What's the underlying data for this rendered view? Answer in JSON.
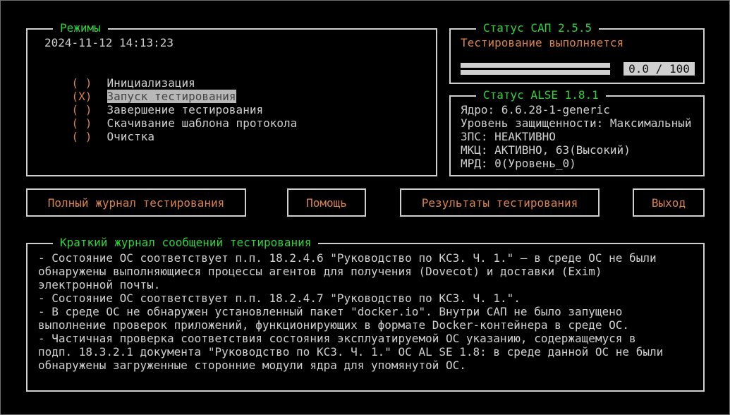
{
  "modes_panel": {
    "title": "Режимы",
    "datetime": "2024-11-12 14:13:23",
    "items": [
      {
        "radio": "( )",
        "label": "Инициализация",
        "selected": false
      },
      {
        "radio": "(X)",
        "label": "Запуск тестирования",
        "selected": true
      },
      {
        "radio": "( )",
        "label": "Завершение тестирования",
        "selected": false
      },
      {
        "radio": "( )",
        "label": "Скачивание шаблона протокола",
        "selected": false
      },
      {
        "radio": "( )",
        "label": "Очистка",
        "selected": false
      }
    ]
  },
  "sap_status": {
    "title": "Статус САП 2.5.5",
    "message": "Тестирование выполняется",
    "progress_text": "0.0 / 100",
    "progress_fraction": 0.0
  },
  "alse_status": {
    "title": "Статус ALSE 1.8.1",
    "lines": [
      "Ядро: 6.6.28-1-generic",
      "Уровень защищенности: Максимальный",
      "ЗПС: НЕАКТИВНО",
      "МКЦ: АКТИВНО, 63(Высокий)",
      "МРД: 0(Уровень_0)"
    ]
  },
  "buttons": {
    "full_log": "Полный журнал тестирования",
    "help": "Помощь",
    "results": "Результаты тестирования",
    "exit": "Выход"
  },
  "log_panel": {
    "title": "Краткий журнал сообщений тестирования",
    "lines": [
      "- Состояние ОС соответствует п.п. 18.2.4.6 \"Руководство по КСЗ. Ч. 1.\" – в среде ОС не были",
      "обнаружены выполняющиеся процессы агентов для получения (Dovecot) и доставки (Exim)",
      "электронной почты.",
      "- Состояние ОС соответствует п.п. 18.2.4.7 \"Руководство по КСЗ. Ч. 1.\".",
      "- В среде ОС не обнаружен установленный пакет \"docker.io\". Внутри САП не было запущено",
      "выполнение проверок приложений, функционирующих в формате Docker-контейнера в среде ОС.",
      "- Частичная проверка соответствия состояния эксплуатируемой ОС указанию, содержащемуся в",
      "подп. 18.3.2.1 документа \"Руководство по КСЗ. Ч. 1.\" ОС AL SE 1.8: в среде данной ОС не были",
      "обнаружены загруженные сторонние модули ядра для упомянутой ОС."
    ]
  },
  "colors": {
    "background": "#000000",
    "border": "#cfcfcf",
    "title_green": "#2fd23a",
    "accent_orange": "#d9834a",
    "text": "#d0d0d0"
  }
}
